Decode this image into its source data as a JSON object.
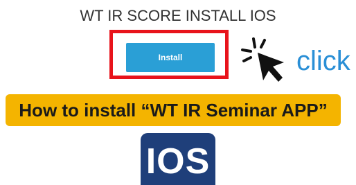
{
  "page": {
    "title": "WT IR SCORE INSTALL IOS"
  },
  "install_button": {
    "label": "Install",
    "color": "#2a9fd6"
  },
  "highlight": {
    "color": "#e8131b"
  },
  "click_hint": {
    "text": "click",
    "icon": "mouse-pointer-click-icon",
    "color": "#2a8fd6"
  },
  "banner": {
    "text": "How to install “WT IR Seminar APP”",
    "color": "#f4b400"
  },
  "ios_badge": {
    "text": "IOS",
    "color": "#1f3f7a"
  }
}
